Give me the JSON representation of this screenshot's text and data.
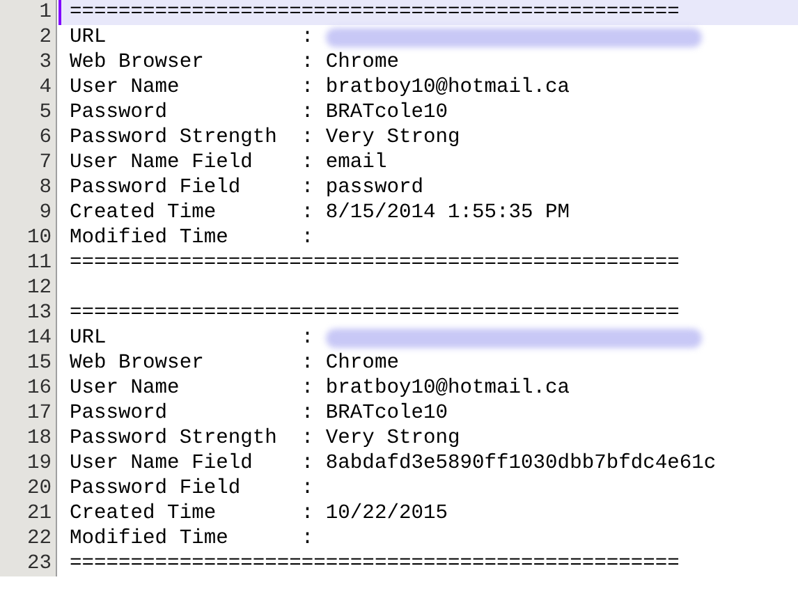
{
  "editor": {
    "lines": [
      {
        "number": "1",
        "text": "==================================================",
        "current": true,
        "redacted": false
      },
      {
        "number": "2",
        "text": "URL                : ",
        "current": false,
        "redacted": true
      },
      {
        "number": "3",
        "text": "Web Browser        : Chrome",
        "current": false,
        "redacted": false
      },
      {
        "number": "4",
        "text": "User Name          : bratboy10@hotmail.ca",
        "current": false,
        "redacted": false
      },
      {
        "number": "5",
        "text": "Password           : BRATcole10",
        "current": false,
        "redacted": false
      },
      {
        "number": "6",
        "text": "Password Strength  : Very Strong",
        "current": false,
        "redacted": false
      },
      {
        "number": "7",
        "text": "User Name Field    : email",
        "current": false,
        "redacted": false
      },
      {
        "number": "8",
        "text": "Password Field     : password",
        "current": false,
        "redacted": false
      },
      {
        "number": "9",
        "text": "Created Time       : 8/15/2014 1:55:35 PM",
        "current": false,
        "redacted": false
      },
      {
        "number": "10",
        "text": "Modified Time      :",
        "current": false,
        "redacted": false
      },
      {
        "number": "11",
        "text": "==================================================",
        "current": false,
        "redacted": false
      },
      {
        "number": "12",
        "current": false,
        "redacted": false
      },
      {
        "number": "13",
        "text": "==================================================",
        "current": false,
        "redacted": false
      },
      {
        "number": "14",
        "text": "URL                : ",
        "current": false,
        "redacted": true
      },
      {
        "number": "15",
        "text": "Web Browser        : Chrome",
        "current": false,
        "redacted": false
      },
      {
        "number": "16",
        "text": "User Name          : bratboy10@hotmail.ca",
        "current": false,
        "redacted": false
      },
      {
        "number": "17",
        "text": "Password           : BRATcole10",
        "current": false,
        "redacted": false
      },
      {
        "number": "18",
        "text": "Password Strength  : Very Strong",
        "current": false,
        "redacted": false
      },
      {
        "number": "19",
        "text": "User Name Field    : 8abdafd3e5890ff1030dbb7bfdc4e61c",
        "current": false,
        "redacted": false
      },
      {
        "number": "20",
        "text": "Password Field     :",
        "current": false,
        "redacted": false
      },
      {
        "number": "21",
        "text": "Created Time       : 10/22/2015",
        "current": false,
        "redacted": false
      },
      {
        "number": "22",
        "text": "Modified Time      :",
        "current": false,
        "redacted": false
      },
      {
        "number": "23",
        "text": "==================================================",
        "current": false,
        "redacted": false
      }
    ]
  }
}
